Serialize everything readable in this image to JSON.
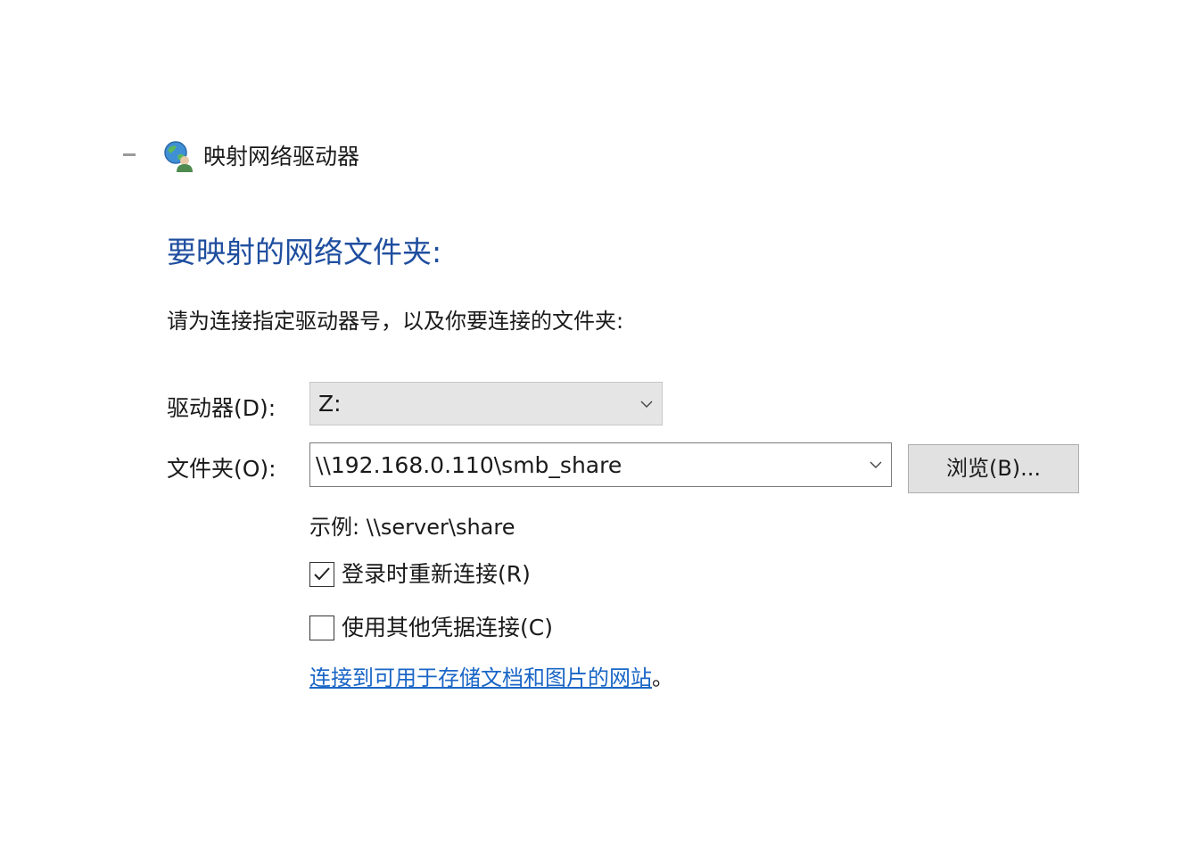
{
  "window": {
    "title": "映射网络驱动器",
    "icon": "network-drive-icon"
  },
  "main": {
    "heading": "要映射的网络文件夹:",
    "instruction": "请为连接指定驱动器号，以及你要连接的文件夹:",
    "drive": {
      "label": "驱动器(D):",
      "value": "Z:"
    },
    "folder": {
      "label": "文件夹(O):",
      "value": "\\\\192.168.0.110\\smb_share",
      "browse_label": "浏览(B)..."
    },
    "example": "示例: \\\\server\\share",
    "reconnect_checkbox": {
      "label": "登录时重新连接(R)",
      "checked": true
    },
    "credentials_checkbox": {
      "label": "使用其他凭据连接(C)",
      "checked": false
    },
    "link": {
      "text": "连接到可用于存储文档和图片的网站",
      "suffix": "。"
    }
  },
  "colors": {
    "heading": "#1f4e9f",
    "link": "#1a66c6",
    "dropdown_bg": "#e5e5e5",
    "button_bg": "#e1e1e1"
  }
}
